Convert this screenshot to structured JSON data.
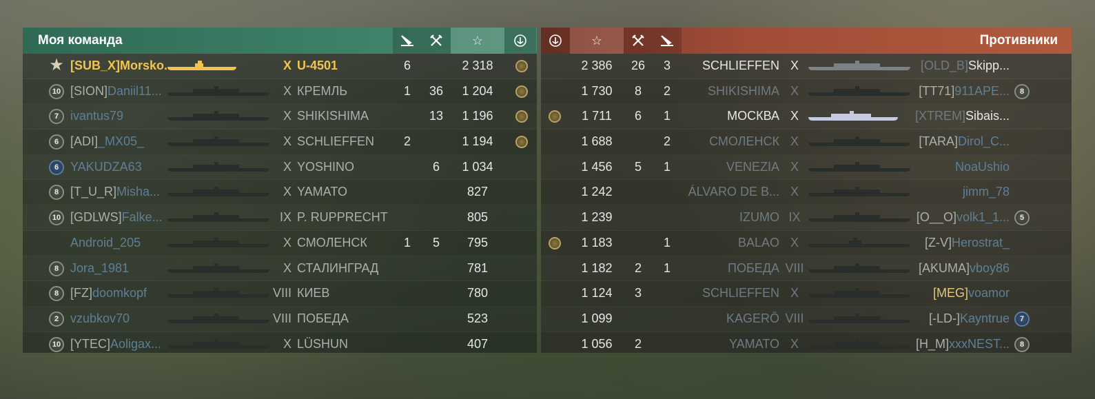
{
  "left_team": {
    "title": "Моя команда",
    "columns": {
      "kills_icon": "torpedo-hit-icon",
      "frags_icon": "crossed-swords-icon",
      "xp_icon": "star-icon",
      "medal_icon": "anchor-wreath-icon"
    },
    "rows": [
      {
        "level": "",
        "badge": "star-icon",
        "tag": "[SUB_X]",
        "name": "Morsko...",
        "tier": "X",
        "ship": "U-4501",
        "c1": "6",
        "c2": "",
        "xp": "2 318",
        "medal": true,
        "highlight": true,
        "shipcolor": "#f0c44e"
      },
      {
        "level": "10",
        "tag": "[SION]",
        "name": "Daniil11...",
        "tier": "X",
        "ship": "КРЕМЛЬ",
        "c1": "1",
        "c2": "36",
        "xp": "1 204",
        "medal": true
      },
      {
        "level": "7",
        "tag": "",
        "name": "ivantus79",
        "tier": "X",
        "ship": "SHIKISHIMA",
        "c1": "",
        "c2": "13",
        "xp": "1 196",
        "medal": true
      },
      {
        "level": "6",
        "tag": "[ADI]",
        "name": "_MX05_",
        "tier": "X",
        "ship": "SCHLIEFFEN",
        "c1": "2",
        "c2": "",
        "xp": "1 194",
        "medal": true
      },
      {
        "level": "6",
        "blue": true,
        "tag": "",
        "name": "YAKUDZA63",
        "tier": "X",
        "ship": "YOSHINO",
        "c1": "",
        "c2": "6",
        "xp": "1 034",
        "medal": false
      },
      {
        "level": "8",
        "tag": "[T_U_R]",
        "name": "Misha...",
        "tier": "X",
        "ship": "YAMATO",
        "c1": "",
        "c2": "",
        "xp": "827",
        "medal": false
      },
      {
        "level": "10",
        "tag": "[GDLWS]",
        "name": "Falke...",
        "tier": "IX",
        "ship": "P. RUPPRECHT",
        "c1": "",
        "c2": "",
        "xp": "805",
        "medal": false
      },
      {
        "level": "",
        "tag": "",
        "name": "Android_205",
        "tier": "X",
        "ship": "СМОЛЕНСК",
        "c1": "1",
        "c2": "5",
        "xp": "795",
        "medal": false
      },
      {
        "level": "8",
        "tag": "",
        "name": "Jora_1981",
        "tier": "X",
        "ship": "СТАЛИНГРАД",
        "c1": "",
        "c2": "",
        "xp": "781",
        "medal": false
      },
      {
        "level": "8",
        "tag": "[FZ]",
        "name": "doomkopf",
        "tier": "VIII",
        "ship": "КИЕВ",
        "c1": "",
        "c2": "",
        "xp": "780",
        "medal": false
      },
      {
        "level": "2",
        "tag": "",
        "name": "vzubkov70",
        "tier": "VIII",
        "ship": "ПОБЕДА",
        "c1": "",
        "c2": "",
        "xp": "523",
        "medal": false
      },
      {
        "level": "10",
        "tag": "[YTEC]",
        "name": "Aoligax...",
        "tier": "X",
        "ship": "LÜSHUN",
        "c1": "",
        "c2": "",
        "xp": "407",
        "medal": false
      }
    ]
  },
  "right_team": {
    "title": "Противники",
    "rows": [
      {
        "medal": false,
        "xp": "2 386",
        "c2": "26",
        "c1": "3",
        "ship": "SCHLIEFFEN",
        "tier": "X",
        "tag": "[OLD_B]",
        "name": "Skipp...",
        "level": "",
        "alive": true
      },
      {
        "medal": false,
        "xp": "1 730",
        "c2": "8",
        "c1": "2",
        "ship": "SHIKISHIMA",
        "tier": "X",
        "tag": "[TT71]",
        "name": "911APE...",
        "level": "8",
        "alive": false
      },
      {
        "medal": true,
        "xp": "1 711",
        "c2": "6",
        "c1": "1",
        "ship": "МОСКВА",
        "tier": "X",
        "tag": "[XTREM]",
        "name": "Sibais...",
        "level": "",
        "alive": true,
        "whiteship": true
      },
      {
        "medal": false,
        "xp": "1 688",
        "c2": "",
        "c1": "2",
        "ship": "СМОЛЕНСК",
        "tier": "X",
        "tag": "[TARA]",
        "name": "Dirol_C...",
        "level": "",
        "alive": false
      },
      {
        "medal": false,
        "xp": "1 456",
        "c2": "5",
        "c1": "1",
        "ship": "VENEZIA",
        "tier": "X",
        "tag": "",
        "name": "NoaUshio",
        "level": "",
        "alive": false
      },
      {
        "medal": false,
        "xp": "1 242",
        "c2": "",
        "c1": "",
        "ship": "ÁLVARO DE B...",
        "tier": "X",
        "tag": "",
        "name": "jimm_78",
        "level": "",
        "alive": false
      },
      {
        "medal": false,
        "xp": "1 239",
        "c2": "",
        "c1": "",
        "ship": "IZUMO",
        "tier": "IX",
        "tag": "[O__O]",
        "name": "volk1_1...",
        "level": "5",
        "alive": false
      },
      {
        "medal": true,
        "xp": "1 183",
        "c2": "",
        "c1": "1",
        "ship": "BALAO",
        "tier": "X",
        "tag": "[Z-V]",
        "name": "Herostrat_",
        "level": "",
        "alive": false
      },
      {
        "medal": false,
        "xp": "1 182",
        "c2": "2",
        "c1": "1",
        "ship": "ПОБЕДА",
        "tier": "VIII",
        "tag": "[AKUMA]",
        "name": "vboy86",
        "level": "",
        "alive": false
      },
      {
        "medal": false,
        "xp": "1 124",
        "c2": "3",
        "c1": "",
        "ship": "SCHLIEFFEN",
        "tier": "X",
        "tag": "[MEG]",
        "name": "voamor",
        "level": "",
        "alive": false,
        "goldtag": true
      },
      {
        "medal": false,
        "xp": "1 099",
        "c2": "",
        "c1": "",
        "ship": "KAGERŌ",
        "tier": "VIII",
        "tag": "[-LD-]",
        "name": "Kayntrue",
        "level": "7",
        "blue": true,
        "alive": false
      },
      {
        "medal": false,
        "xp": "1 056",
        "c2": "2",
        "c1": "",
        "ship": "YAMATO",
        "tier": "X",
        "tag": "[H_M]",
        "name": "xxxNEST...",
        "level": "8",
        "alive": false
      }
    ]
  }
}
